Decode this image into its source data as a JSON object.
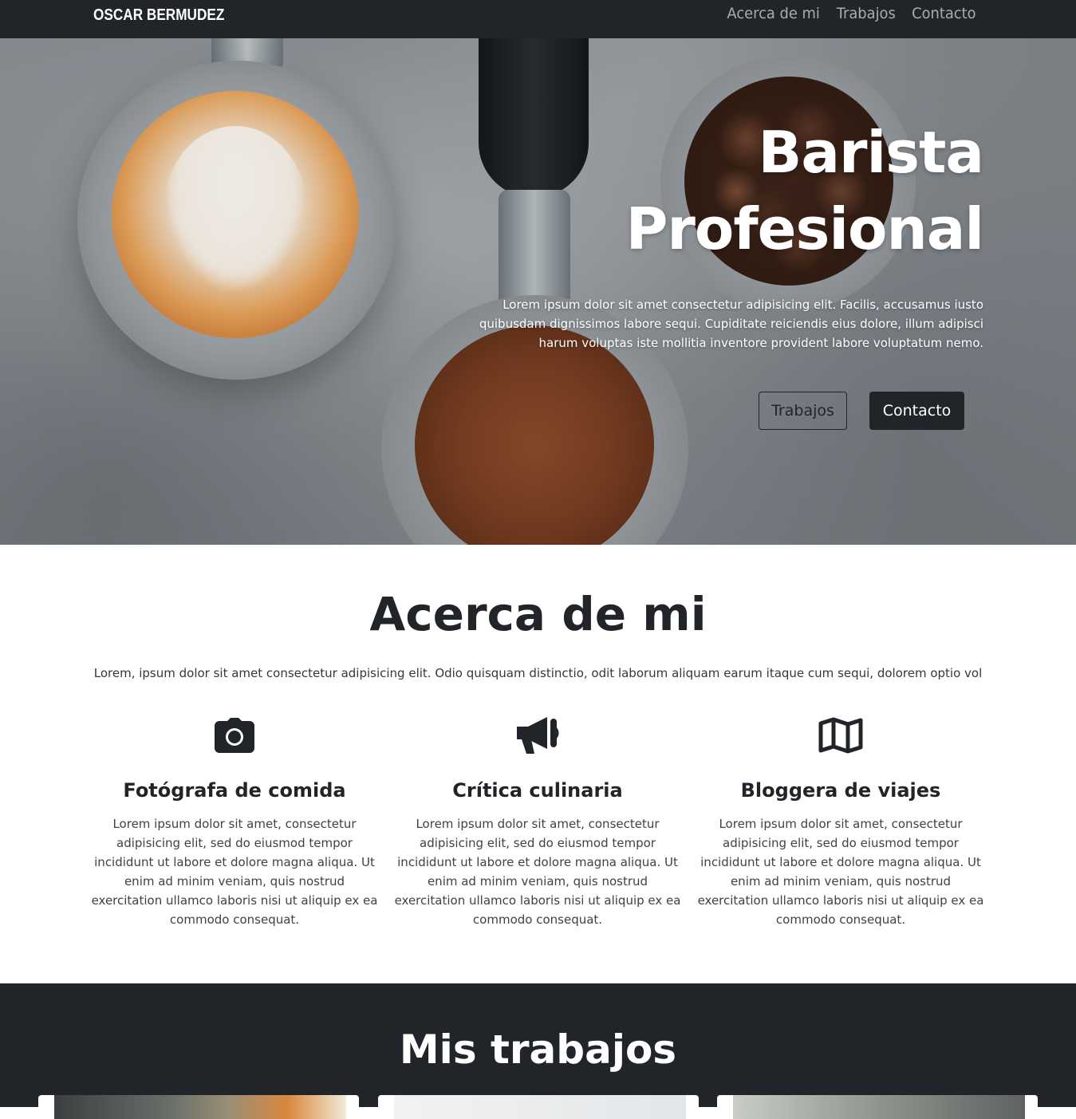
{
  "navbar": {
    "brand": "OSCAR BERMUDEZ",
    "links": [
      "Acerca de mi",
      "Trabajos",
      "Contacto"
    ]
  },
  "hero": {
    "title_line1": "Barista",
    "title_line2": "Profesional",
    "text": "Lorem ipsum dolor sit amet consectetur adipisicing elit. Facilis, accusamus iusto quibusdam dignissimos labore sequi. Cupiditate reiciendis eius dolore, illum adipisci harum voluptas iste mollitia inventore provident labore voluptatum nemo.",
    "buttons": {
      "works": "Trabajos",
      "contact": "Contacto"
    }
  },
  "about": {
    "title": "Acerca de mi",
    "lead": "Lorem, ipsum dolor sit amet consectetur adipisicing elit. Odio quisquam distinctio, odit laborum aliquam earum itaque cum sequi, dolorem optio vol",
    "features": [
      {
        "icon": "camera-icon",
        "title": "Fotógrafa de comida",
        "text": "Lorem ipsum dolor sit amet, consectetur adipisicing elit, sed do eiusmod tempor incididunt ut labore et dolore magna aliqua. Ut enim ad minim veniam, quis nostrud exercitation ullamco laboris nisi ut aliquip ex ea commodo consequat."
      },
      {
        "icon": "megaphone-icon",
        "title": "Crítica culinaria",
        "text": "Lorem ipsum dolor sit amet, consectetur adipisicing elit, sed do eiusmod tempor incididunt ut labore et dolore magna aliqua. Ut enim ad minim veniam, quis nostrud exercitation ullamco laboris nisi ut aliquip ex ea commodo consequat."
      },
      {
        "icon": "map-icon",
        "title": "Bloggera de viajes",
        "text": "Lorem ipsum dolor sit amet, consectetur adipisicing elit, sed do eiusmod tempor incididunt ut labore et dolore magna aliqua. Ut enim ad minim veniam, quis nostrud exercitation ullamco laboris nisi ut aliquip ex ea commodo consequat."
      }
    ]
  },
  "works": {
    "title": "Mis trabajos"
  },
  "colors": {
    "dark": "#212529",
    "white": "#ffffff"
  }
}
